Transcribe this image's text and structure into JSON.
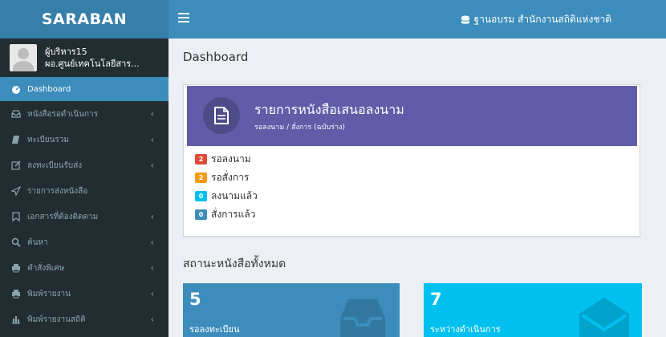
{
  "brand": {
    "logo": "SARABAN"
  },
  "user": {
    "name": "ผู้บริหาร15",
    "position": "ผอ.ศูนย์เทคโนโลยีสาร..."
  },
  "header": {
    "org": "ฐานอบรม สำนักงานสถิติแห่งชาติ"
  },
  "sidebar": {
    "items": [
      {
        "label": "Dashboard",
        "icon": "dashboard-icon"
      },
      {
        "label": "หนังสือรอดำเนินการ",
        "icon": "inbox-icon"
      },
      {
        "label": "ทะเบียนรวม",
        "icon": "book-icon"
      },
      {
        "label": "ลงทะเบียนรับส่ง",
        "icon": "edit-icon"
      },
      {
        "label": "รายการส่งหนังสือ",
        "icon": "send-icon"
      },
      {
        "label": "เอกสารที่ต้องติดตาม",
        "icon": "bookmark-icon"
      },
      {
        "label": "ค้นหา",
        "icon": "search-icon"
      },
      {
        "label": "คำสั่งพิเศษ",
        "icon": "print-icon"
      },
      {
        "label": "พิมพ์รายงาน",
        "icon": "print-icon"
      },
      {
        "label": "พิมพ์รายงานสถิติ",
        "icon": "bar-chart-icon"
      }
    ]
  },
  "main": {
    "page_title": "Dashboard",
    "sign_box": {
      "title": "รายการหนังสือเสนอลงนาม",
      "subtitle": "รอลงนาม / สั่งการ (ฉบับร่าง)",
      "items": [
        {
          "count": "2",
          "label": "รอลงนาม",
          "color": "#dd4b39"
        },
        {
          "count": "2",
          "label": "รอสั่งการ",
          "color": "#f39c12"
        },
        {
          "count": "0",
          "label": "ลงนามแล้ว",
          "color": "#00c0ef"
        },
        {
          "count": "0",
          "label": "สั่งการแล้ว",
          "color": "#3c8dbc"
        }
      ]
    },
    "section_title": "สถานะหนังสือทั้งหมด",
    "stats": [
      {
        "value": "5",
        "label": "รอลงทะเบียน",
        "color": "#3c8dbc",
        "icon": "inbox-icon"
      },
      {
        "value": "7",
        "label": "ระหว่างดำเนินการ",
        "color": "#00c0ef",
        "icon": "envelope-icon"
      }
    ]
  }
}
